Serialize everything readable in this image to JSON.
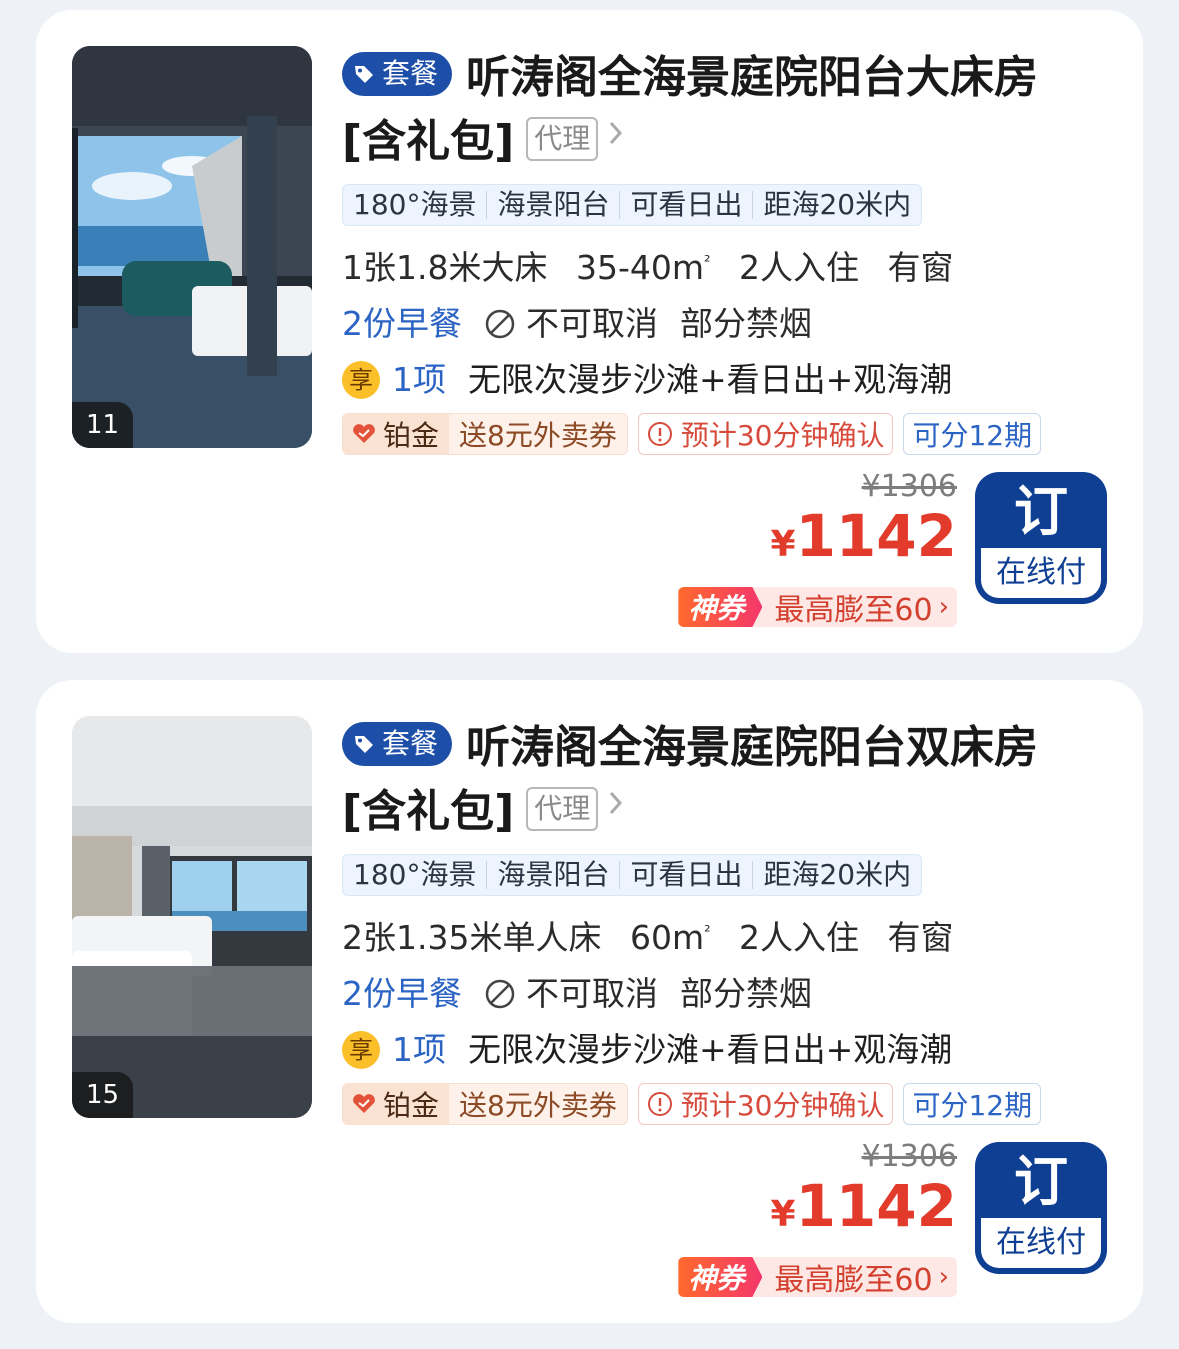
{
  "rooms": [
    {
      "photo_count": "11",
      "package_badge": "套餐",
      "title_line1": "听涛阁全海景庭院阳台大床房",
      "title_line2": "[含礼包]",
      "agent_tag": "代理",
      "features": [
        "180°海景",
        "海景阳台",
        "可看日出",
        "距海20米内"
      ],
      "bed": "1张1.8米大床",
      "area": "35-40m",
      "area_unit": "²",
      "occupancy": "2人入住",
      "window": "有窗",
      "breakfast": "2份早餐",
      "cancel": "不可取消",
      "smoking": "部分禁烟",
      "perk_badge": "享",
      "perk_count": "1项",
      "perk_text": "无限次漫步沙滩+看日出+观海潮",
      "vip_level": "铂金",
      "vip_gift": "送8元外卖券",
      "confirm": "预计30分钟确认",
      "installment": "可分12期",
      "original_price": "¥1306",
      "currency": "¥",
      "price": "1142",
      "coupon_badge": "神券",
      "coupon_text": "最高膨至60",
      "book_label": "订",
      "pay_label": "在线付"
    },
    {
      "photo_count": "15",
      "package_badge": "套餐",
      "title_line1": "听涛阁全海景庭院阳台双床房",
      "title_line2": "[含礼包]",
      "agent_tag": "代理",
      "features": [
        "180°海景",
        "海景阳台",
        "可看日出",
        "距海20米内"
      ],
      "bed": "2张1.35米单人床",
      "area": "60m",
      "area_unit": "²",
      "occupancy": "2人入住",
      "window": "有窗",
      "breakfast": "2份早餐",
      "cancel": "不可取消",
      "smoking": "部分禁烟",
      "perk_badge": "享",
      "perk_count": "1项",
      "perk_text": "无限次漫步沙滩+看日出+观海潮",
      "vip_level": "铂金",
      "vip_gift": "送8元外卖券",
      "confirm": "预计30分钟确认",
      "installment": "可分12期",
      "original_price": "¥1306",
      "currency": "¥",
      "price": "1142",
      "coupon_badge": "神券",
      "coupon_text": "最高膨至60",
      "book_label": "订",
      "pay_label": "在线付"
    }
  ],
  "colors": {
    "brand_blue": "#0f3f93",
    "link_blue": "#2c64c4",
    "price_red": "#e23a2b",
    "confirm_red": "#d74b3c",
    "background": "#eef1f6"
  },
  "icons": [
    "tag-icon",
    "chevron-right-icon",
    "no-cancel-icon",
    "heart-icon",
    "clock-alert-icon",
    "room-photo-image"
  ]
}
